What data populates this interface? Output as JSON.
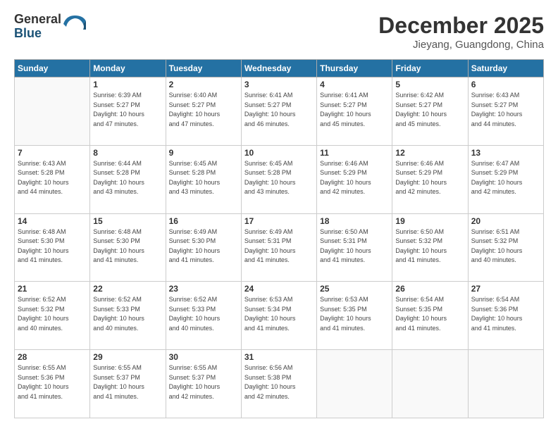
{
  "logo": {
    "general": "General",
    "blue": "Blue"
  },
  "header": {
    "month": "December 2025",
    "location": "Jieyang, Guangdong, China"
  },
  "weekdays": [
    "Sunday",
    "Monday",
    "Tuesday",
    "Wednesday",
    "Thursday",
    "Friday",
    "Saturday"
  ],
  "weeks": [
    [
      {
        "day": "",
        "empty": true
      },
      {
        "day": "1",
        "sunrise": "6:39 AM",
        "sunset": "5:27 PM",
        "daylight": "10 hours and 47 minutes."
      },
      {
        "day": "2",
        "sunrise": "6:40 AM",
        "sunset": "5:27 PM",
        "daylight": "10 hours and 47 minutes."
      },
      {
        "day": "3",
        "sunrise": "6:41 AM",
        "sunset": "5:27 PM",
        "daylight": "10 hours and 46 minutes."
      },
      {
        "day": "4",
        "sunrise": "6:41 AM",
        "sunset": "5:27 PM",
        "daylight": "10 hours and 45 minutes."
      },
      {
        "day": "5",
        "sunrise": "6:42 AM",
        "sunset": "5:27 PM",
        "daylight": "10 hours and 45 minutes."
      },
      {
        "day": "6",
        "sunrise": "6:43 AM",
        "sunset": "5:27 PM",
        "daylight": "10 hours and 44 minutes."
      }
    ],
    [
      {
        "day": "7",
        "sunrise": "6:43 AM",
        "sunset": "5:28 PM",
        "daylight": "10 hours and 44 minutes."
      },
      {
        "day": "8",
        "sunrise": "6:44 AM",
        "sunset": "5:28 PM",
        "daylight": "10 hours and 43 minutes."
      },
      {
        "day": "9",
        "sunrise": "6:45 AM",
        "sunset": "5:28 PM",
        "daylight": "10 hours and 43 minutes."
      },
      {
        "day": "10",
        "sunrise": "6:45 AM",
        "sunset": "5:28 PM",
        "daylight": "10 hours and 43 minutes."
      },
      {
        "day": "11",
        "sunrise": "6:46 AM",
        "sunset": "5:29 PM",
        "daylight": "10 hours and 42 minutes."
      },
      {
        "day": "12",
        "sunrise": "6:46 AM",
        "sunset": "5:29 PM",
        "daylight": "10 hours and 42 minutes."
      },
      {
        "day": "13",
        "sunrise": "6:47 AM",
        "sunset": "5:29 PM",
        "daylight": "10 hours and 42 minutes."
      }
    ],
    [
      {
        "day": "14",
        "sunrise": "6:48 AM",
        "sunset": "5:30 PM",
        "daylight": "10 hours and 41 minutes."
      },
      {
        "day": "15",
        "sunrise": "6:48 AM",
        "sunset": "5:30 PM",
        "daylight": "10 hours and 41 minutes."
      },
      {
        "day": "16",
        "sunrise": "6:49 AM",
        "sunset": "5:30 PM",
        "daylight": "10 hours and 41 minutes."
      },
      {
        "day": "17",
        "sunrise": "6:49 AM",
        "sunset": "5:31 PM",
        "daylight": "10 hours and 41 minutes."
      },
      {
        "day": "18",
        "sunrise": "6:50 AM",
        "sunset": "5:31 PM",
        "daylight": "10 hours and 41 minutes."
      },
      {
        "day": "19",
        "sunrise": "6:50 AM",
        "sunset": "5:32 PM",
        "daylight": "10 hours and 41 minutes."
      },
      {
        "day": "20",
        "sunrise": "6:51 AM",
        "sunset": "5:32 PM",
        "daylight": "10 hours and 40 minutes."
      }
    ],
    [
      {
        "day": "21",
        "sunrise": "6:52 AM",
        "sunset": "5:32 PM",
        "daylight": "10 hours and 40 minutes."
      },
      {
        "day": "22",
        "sunrise": "6:52 AM",
        "sunset": "5:33 PM",
        "daylight": "10 hours and 40 minutes."
      },
      {
        "day": "23",
        "sunrise": "6:52 AM",
        "sunset": "5:33 PM",
        "daylight": "10 hours and 40 minutes."
      },
      {
        "day": "24",
        "sunrise": "6:53 AM",
        "sunset": "5:34 PM",
        "daylight": "10 hours and 41 minutes."
      },
      {
        "day": "25",
        "sunrise": "6:53 AM",
        "sunset": "5:35 PM",
        "daylight": "10 hours and 41 minutes."
      },
      {
        "day": "26",
        "sunrise": "6:54 AM",
        "sunset": "5:35 PM",
        "daylight": "10 hours and 41 minutes."
      },
      {
        "day": "27",
        "sunrise": "6:54 AM",
        "sunset": "5:36 PM",
        "daylight": "10 hours and 41 minutes."
      }
    ],
    [
      {
        "day": "28",
        "sunrise": "6:55 AM",
        "sunset": "5:36 PM",
        "daylight": "10 hours and 41 minutes."
      },
      {
        "day": "29",
        "sunrise": "6:55 AM",
        "sunset": "5:37 PM",
        "daylight": "10 hours and 41 minutes."
      },
      {
        "day": "30",
        "sunrise": "6:55 AM",
        "sunset": "5:37 PM",
        "daylight": "10 hours and 42 minutes."
      },
      {
        "day": "31",
        "sunrise": "6:56 AM",
        "sunset": "5:38 PM",
        "daylight": "10 hours and 42 minutes."
      },
      {
        "day": "",
        "empty": true
      },
      {
        "day": "",
        "empty": true
      },
      {
        "day": "",
        "empty": true
      }
    ]
  ]
}
